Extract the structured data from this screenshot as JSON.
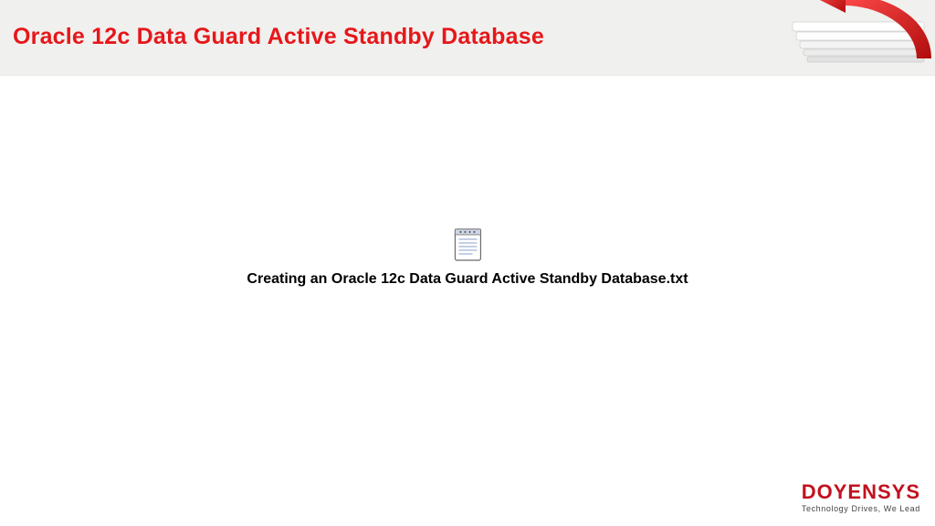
{
  "header": {
    "title": "Oracle 12c Data Guard Active Standby Database"
  },
  "file": {
    "name": "Creating an Oracle 12c Data Guard Active Standby Database.txt"
  },
  "footer": {
    "brand": "DOYENSYS",
    "tagline": "Technology Drives, We Lead"
  },
  "colors": {
    "accent_red": "#e6171a",
    "brand_red": "#c1121f",
    "header_bg": "#f0f0ee"
  }
}
